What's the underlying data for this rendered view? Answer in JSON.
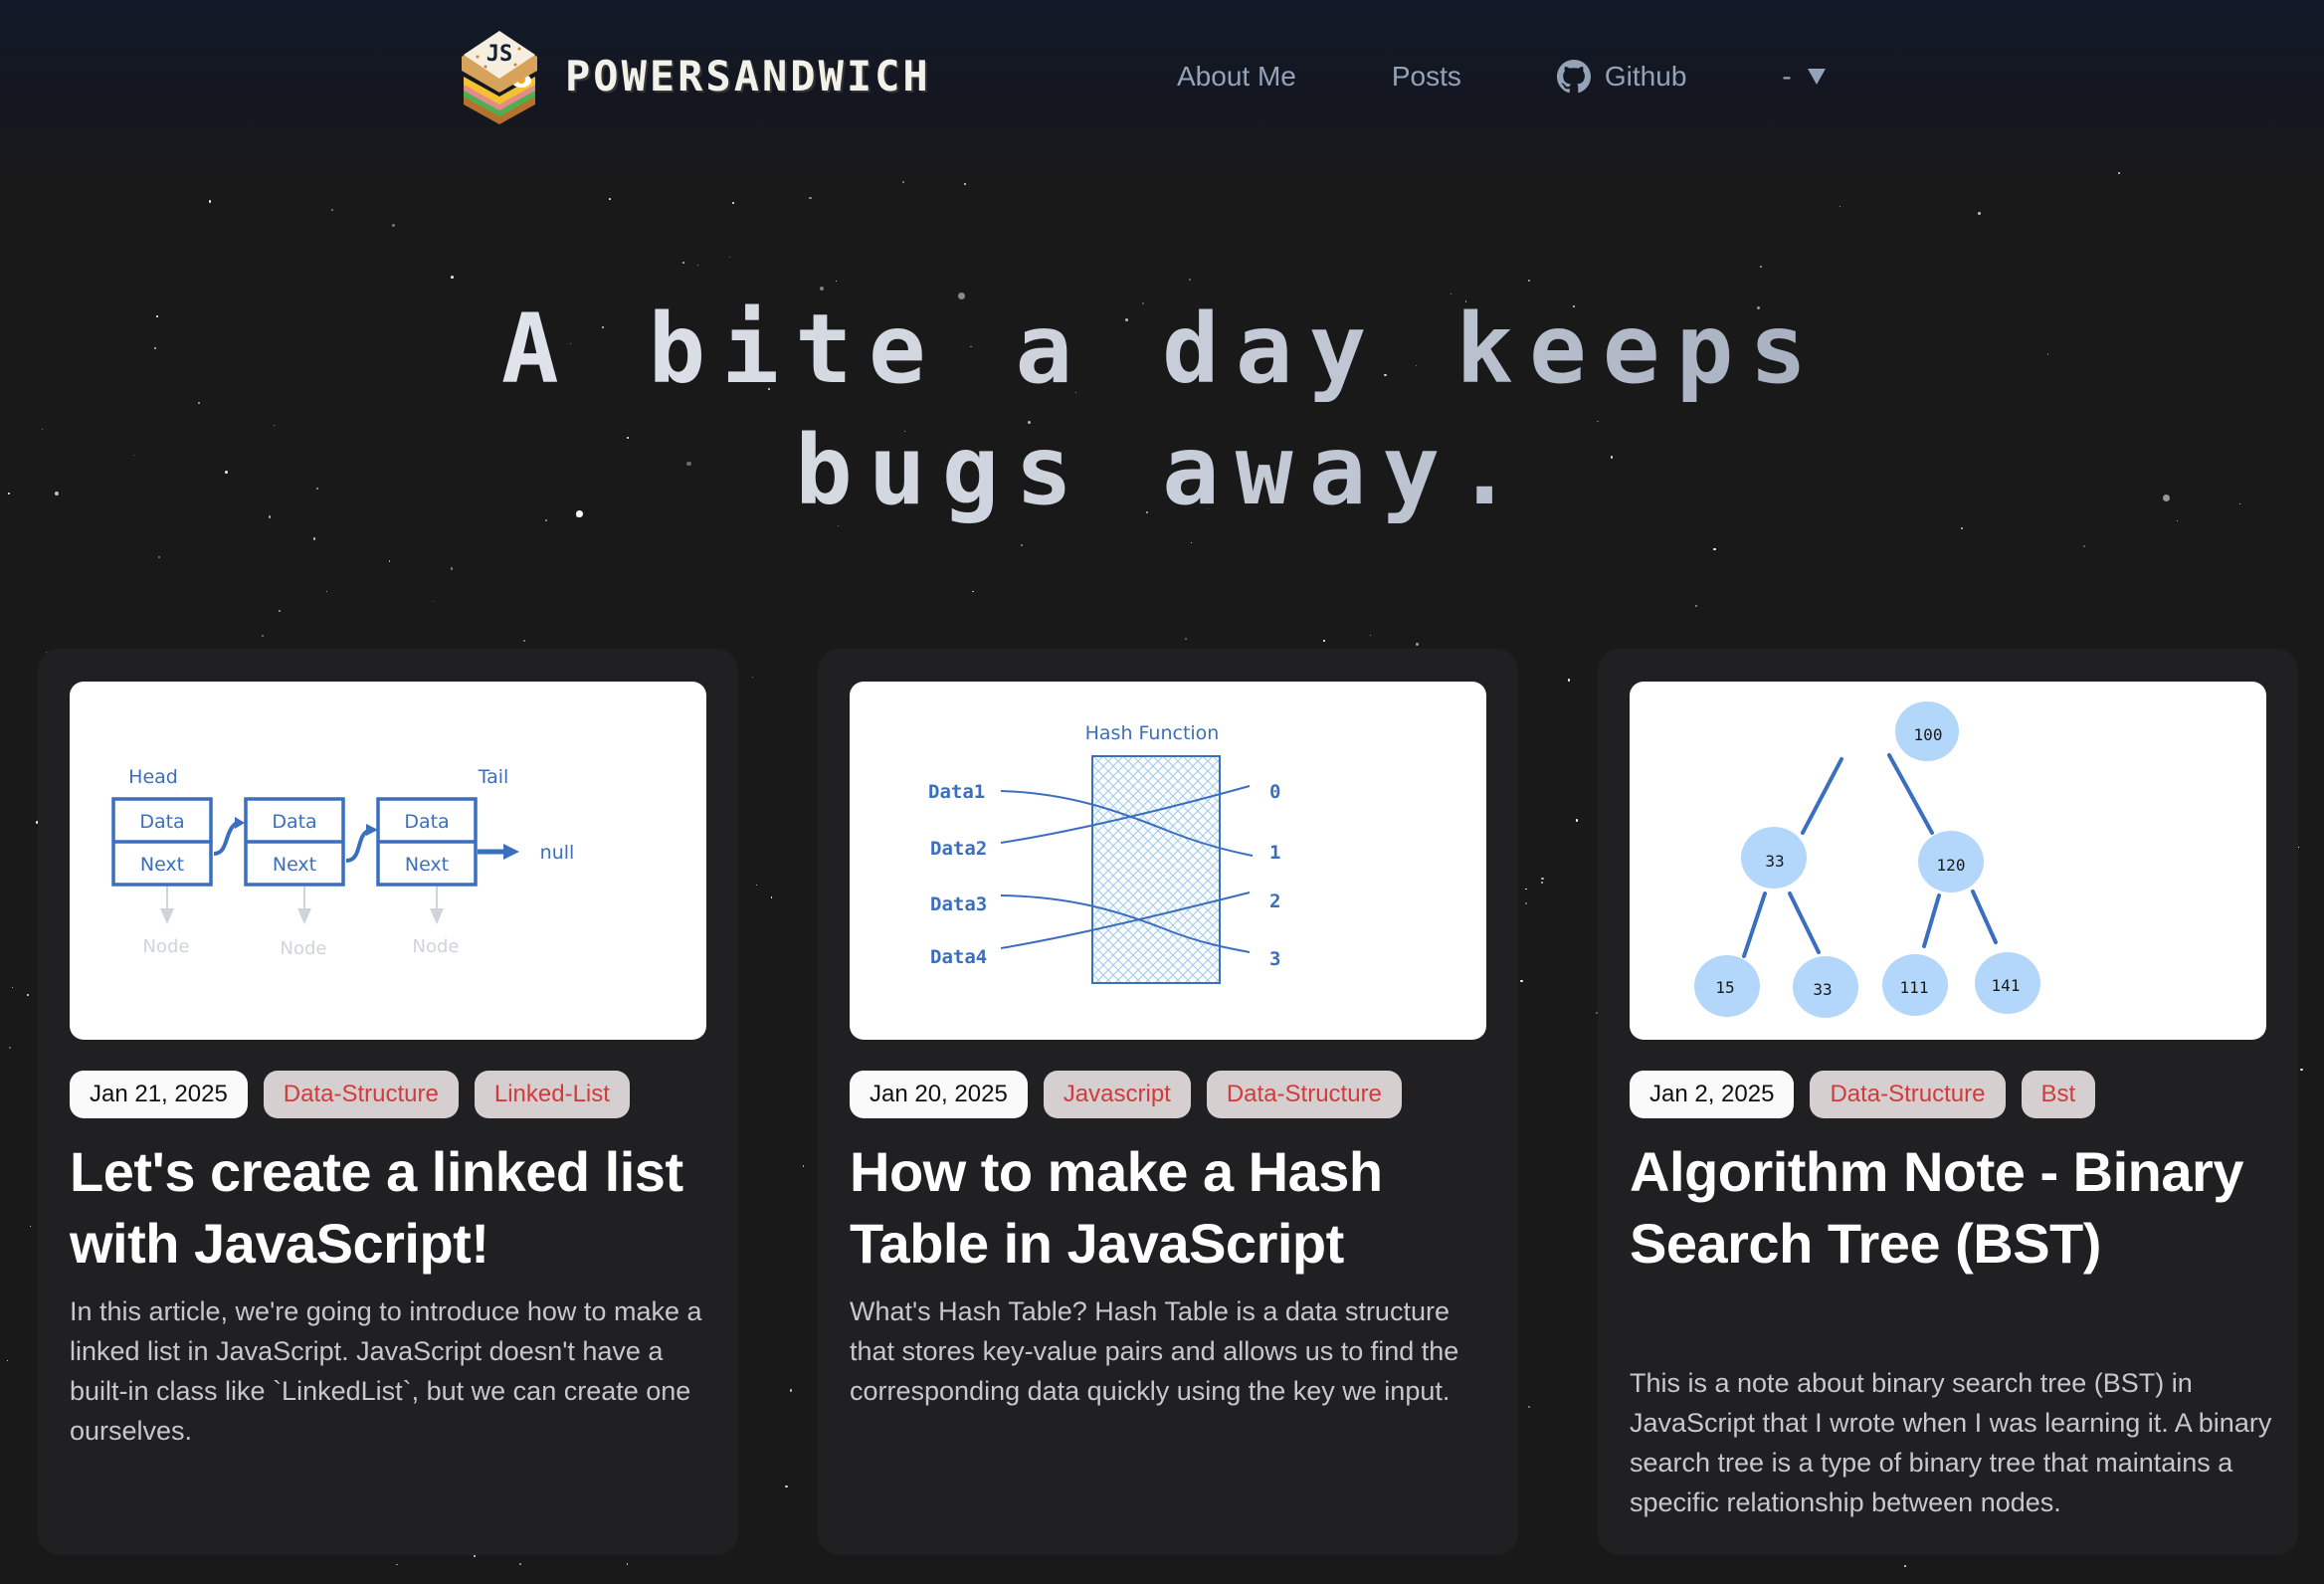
{
  "header": {
    "brand": "POWERSANDWICH",
    "logo_icon": "js-sandwich-logo",
    "nav": [
      {
        "label": "About Me"
      },
      {
        "label": "Posts"
      },
      {
        "label": "Github",
        "icon": "github-icon"
      }
    ],
    "dropdown": {
      "value": "-",
      "icon": "caret-down-icon"
    }
  },
  "hero": {
    "line1": "A bite a day keeps",
    "line2": "bugs away."
  },
  "posts": [
    {
      "date": "Jan 21, 2025",
      "tags": [
        "Data-Structure",
        "Linked-List"
      ],
      "title": "Let's create a linked list with JavaScript!",
      "description": "In this article, we're going to introduce how to make a linked list in JavaScript. JavaScript doesn't have a built-in class like `LinkedList`, but we can create one ourselves.",
      "thumbnail": {
        "kind": "linked-list-diagram",
        "head_label": "Head",
        "tail_label": "Tail",
        "data_label": "Data",
        "next_label": "Next",
        "node_label": "Node",
        "null_label": "null"
      }
    },
    {
      "date": "Jan 20, 2025",
      "tags": [
        "Javascript",
        "Data-Structure"
      ],
      "title": "How to make a Hash Table in JavaScript",
      "description": "What's Hash Table? Hash Table is a data structure that stores key-value pairs and allows us to find the corresponding data quickly using the key we input.",
      "thumbnail": {
        "kind": "hash-function-diagram",
        "title": "Hash Function",
        "inputs": [
          "Data1",
          "Data2",
          "Data3",
          "Data4"
        ],
        "outputs": [
          "0",
          "1",
          "2",
          "3"
        ]
      }
    },
    {
      "date": "Jan 2, 2025",
      "tags": [
        "Data-Structure",
        "Bst"
      ],
      "title": "Algorithm Note - Binary Search Tree (BST)",
      "description": "This is a note about binary search tree (BST) in JavaScript that I wrote when I was learning it. A binary search tree is a type of binary tree that maintains a specific relationship between nodes.",
      "thumbnail": {
        "kind": "bst-diagram",
        "nodes": [
          "100",
          "33",
          "120",
          "15",
          "33",
          "111",
          "141"
        ]
      }
    }
  ],
  "colors": {
    "header_bg": "#111827",
    "page_bg": "#191919",
    "card_bg": "#202022",
    "nav_text": "#94a3b8",
    "tag_bg": "#d6cfcf",
    "tag_text": "#d23b3b",
    "diagram_blue": "#3a6fc0",
    "bst_node": "#b3d7fa"
  }
}
